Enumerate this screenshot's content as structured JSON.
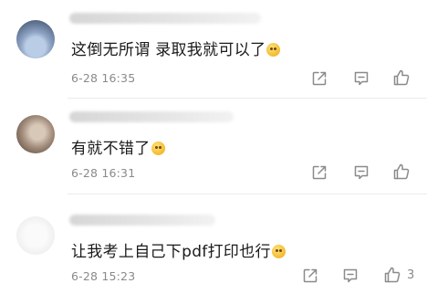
{
  "comments": [
    {
      "text": "这倒无所谓 录取我就可以了",
      "emoji": "smirk-emoji",
      "time": "6-28 16:35",
      "likes": ""
    },
    {
      "text": "有就不错了",
      "emoji": "smile-emoji",
      "time": "6-28 16:31",
      "likes": ""
    },
    {
      "text": "让我考上自己下pdf打印也行",
      "emoji": "smirk-emoji",
      "time": "6-28 15:23",
      "likes": "3"
    }
  ],
  "icons": {
    "share": "share-icon",
    "reply": "comment-icon",
    "like": "thumbs-up-icon"
  },
  "colors": {
    "text": "#1a1a1a",
    "meta": "#8a8a8a",
    "icon": "#8a8a8a",
    "divider": "#ececec"
  }
}
